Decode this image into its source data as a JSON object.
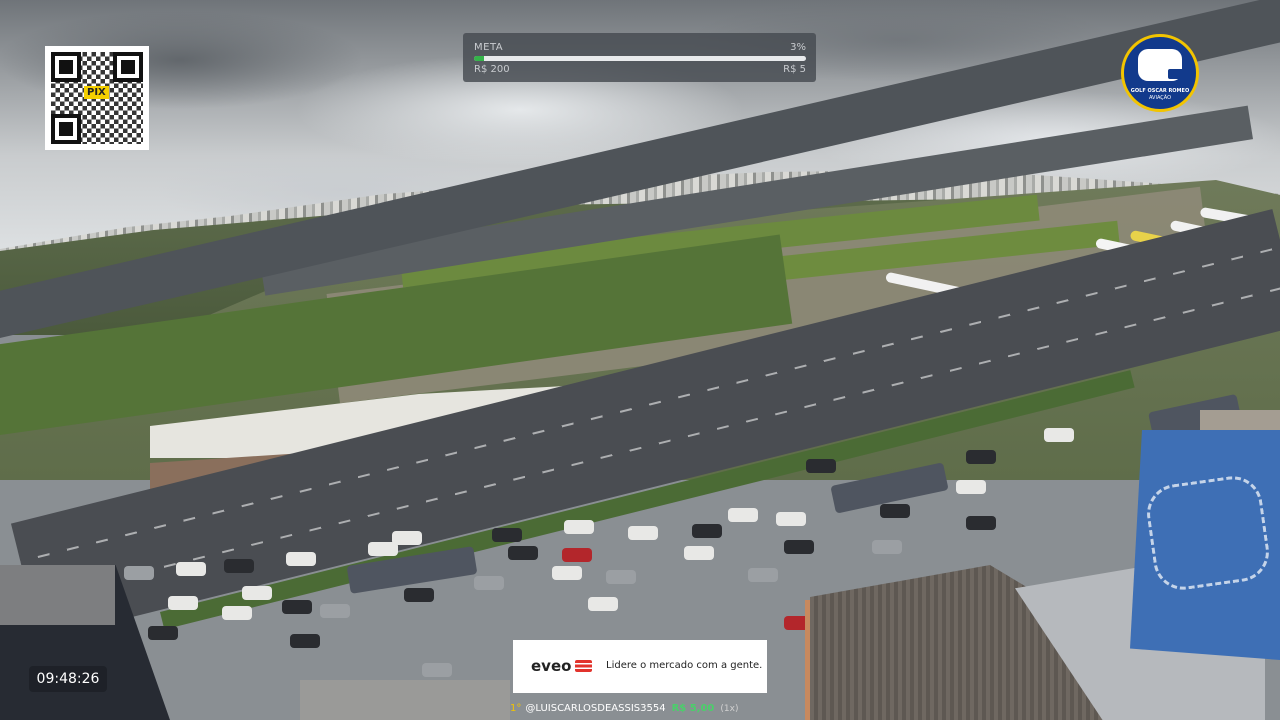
{
  "qr": {
    "label": "PIX"
  },
  "goal": {
    "title": "META",
    "percent_text": "3%",
    "progress": 0.03,
    "target": "R$ 200",
    "current": "R$ 5"
  },
  "logo": {
    "line1": "GOLF OSCAR ROMEO",
    "line2": "AVIAÇÃO"
  },
  "clock": {
    "time": "09:48:26"
  },
  "ad": {
    "brand": "eveo",
    "slogan": "Lidere o mercado com a gente."
  },
  "ticker": {
    "icon": "1st-place-icon",
    "rank": "1°",
    "user": "@LUISCARLOSDEASSIS3554",
    "amount": "R$ 5,00",
    "count": "(1x)"
  },
  "colors": {
    "goal_fill": "#35b44a",
    "logo_blue": "#123a8c",
    "logo_gold": "#f2c400",
    "ad_red": "#e2332c",
    "amount_green": "#4ad06a"
  }
}
